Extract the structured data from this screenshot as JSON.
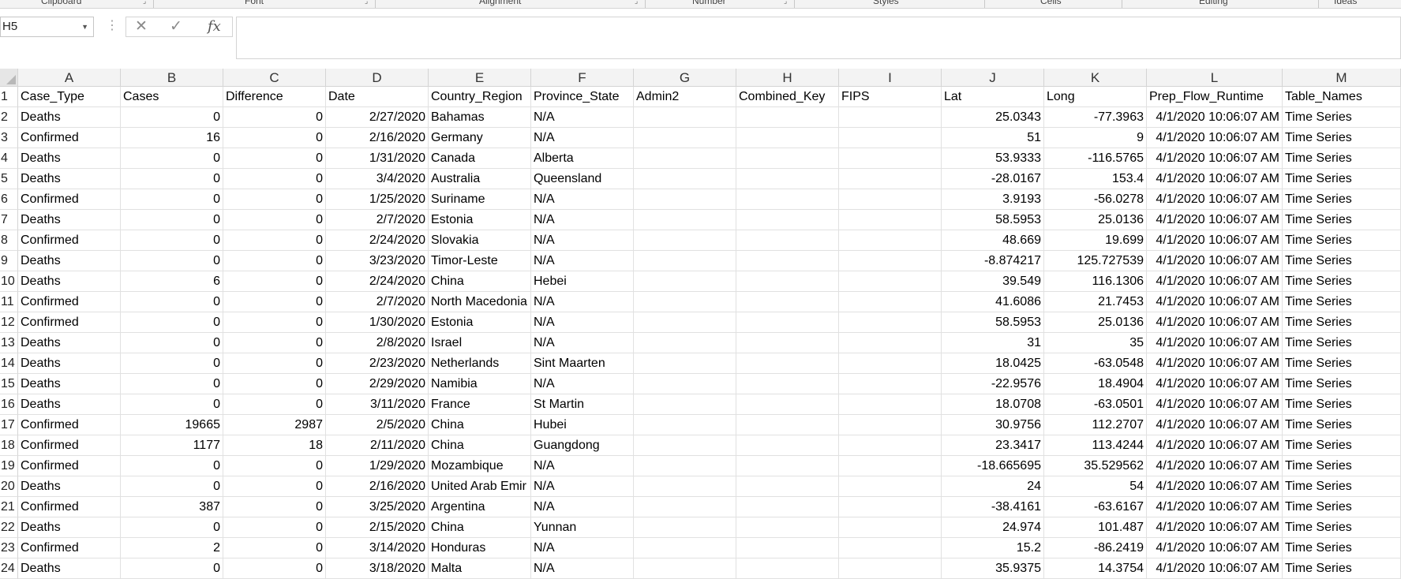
{
  "ribbon_groups": [
    "Clipboard",
    "Font",
    "Alignment",
    "Number",
    "Styles",
    "Cells",
    "Editing",
    "Ideas"
  ],
  "formula_bar": {
    "name_box": "H5",
    "cancel_icon": "✕",
    "enter_icon": "✓",
    "function_label": "fx",
    "formula_value": ""
  },
  "columns": [
    "A",
    "B",
    "C",
    "D",
    "E",
    "F",
    "G",
    "H",
    "I",
    "J",
    "K",
    "L",
    "M"
  ],
  "rows": [
    {
      "n": "1",
      "cells": [
        "Case_Type",
        "Cases",
        "Difference",
        "Date",
        "Country_Region",
        "Province_State",
        "Admin2",
        "Combined_Key",
        "FIPS",
        "Lat",
        "Long",
        "Prep_Flow_Runtime",
        "Table_Names"
      ]
    },
    {
      "n": "2",
      "cells": [
        "Deaths",
        "0",
        "0",
        "2/27/2020",
        "Bahamas",
        "N/A",
        "",
        "",
        "",
        "25.0343",
        "-77.3963",
        "4/1/2020 10:06:07 AM",
        "Time Series"
      ]
    },
    {
      "n": "3",
      "cells": [
        "Confirmed",
        "16",
        "0",
        "2/16/2020",
        "Germany",
        "N/A",
        "",
        "",
        "",
        "51",
        "9",
        "4/1/2020 10:06:07 AM",
        "Time Series"
      ]
    },
    {
      "n": "4",
      "cells": [
        "Deaths",
        "0",
        "0",
        "1/31/2020",
        "Canada",
        "Alberta",
        "",
        "",
        "",
        "53.9333",
        "-116.5765",
        "4/1/2020 10:06:07 AM",
        "Time Series"
      ]
    },
    {
      "n": "5",
      "cells": [
        "Deaths",
        "0",
        "0",
        "3/4/2020",
        "Australia",
        "Queensland",
        "",
        "",
        "",
        "-28.0167",
        "153.4",
        "4/1/2020 10:06:07 AM",
        "Time Series"
      ]
    },
    {
      "n": "6",
      "cells": [
        "Confirmed",
        "0",
        "0",
        "1/25/2020",
        "Suriname",
        "N/A",
        "",
        "",
        "",
        "3.9193",
        "-56.0278",
        "4/1/2020 10:06:07 AM",
        "Time Series"
      ]
    },
    {
      "n": "7",
      "cells": [
        "Deaths",
        "0",
        "0",
        "2/7/2020",
        "Estonia",
        "N/A",
        "",
        "",
        "",
        "58.5953",
        "25.0136",
        "4/1/2020 10:06:07 AM",
        "Time Series"
      ]
    },
    {
      "n": "8",
      "cells": [
        "Confirmed",
        "0",
        "0",
        "2/24/2020",
        "Slovakia",
        "N/A",
        "",
        "",
        "",
        "48.669",
        "19.699",
        "4/1/2020 10:06:07 AM",
        "Time Series"
      ]
    },
    {
      "n": "9",
      "cells": [
        "Deaths",
        "0",
        "0",
        "3/23/2020",
        "Timor-Leste",
        "N/A",
        "",
        "",
        "",
        "-8.874217",
        "125.727539",
        "4/1/2020 10:06:07 AM",
        "Time Series"
      ]
    },
    {
      "n": "10",
      "cells": [
        "Deaths",
        "6",
        "0",
        "2/24/2020",
        "China",
        "Hebei",
        "",
        "",
        "",
        "39.549",
        "116.1306",
        "4/1/2020 10:06:07 AM",
        "Time Series"
      ]
    },
    {
      "n": "11",
      "cells": [
        "Confirmed",
        "0",
        "0",
        "2/7/2020",
        "North Macedonia",
        "N/A",
        "",
        "",
        "",
        "41.6086",
        "21.7453",
        "4/1/2020 10:06:07 AM",
        "Time Series"
      ]
    },
    {
      "n": "12",
      "cells": [
        "Confirmed",
        "0",
        "0",
        "1/30/2020",
        "Estonia",
        "N/A",
        "",
        "",
        "",
        "58.5953",
        "25.0136",
        "4/1/2020 10:06:07 AM",
        "Time Series"
      ]
    },
    {
      "n": "13",
      "cells": [
        "Deaths",
        "0",
        "0",
        "2/8/2020",
        "Israel",
        "N/A",
        "",
        "",
        "",
        "31",
        "35",
        "4/1/2020 10:06:07 AM",
        "Time Series"
      ]
    },
    {
      "n": "14",
      "cells": [
        "Deaths",
        "0",
        "0",
        "2/23/2020",
        "Netherlands",
        "Sint Maarten",
        "",
        "",
        "",
        "18.0425",
        "-63.0548",
        "4/1/2020 10:06:07 AM",
        "Time Series"
      ]
    },
    {
      "n": "15",
      "cells": [
        "Deaths",
        "0",
        "0",
        "2/29/2020",
        "Namibia",
        "N/A",
        "",
        "",
        "",
        "-22.9576",
        "18.4904",
        "4/1/2020 10:06:07 AM",
        "Time Series"
      ]
    },
    {
      "n": "16",
      "cells": [
        "Deaths",
        "0",
        "0",
        "3/11/2020",
        "France",
        "St Martin",
        "",
        "",
        "",
        "18.0708",
        "-63.0501",
        "4/1/2020 10:06:07 AM",
        "Time Series"
      ]
    },
    {
      "n": "17",
      "cells": [
        "Confirmed",
        "19665",
        "2987",
        "2/5/2020",
        "China",
        "Hubei",
        "",
        "",
        "",
        "30.9756",
        "112.2707",
        "4/1/2020 10:06:07 AM",
        "Time Series"
      ]
    },
    {
      "n": "18",
      "cells": [
        "Confirmed",
        "1177",
        "18",
        "2/11/2020",
        "China",
        "Guangdong",
        "",
        "",
        "",
        "23.3417",
        "113.4244",
        "4/1/2020 10:06:07 AM",
        "Time Series"
      ]
    },
    {
      "n": "19",
      "cells": [
        "Confirmed",
        "0",
        "0",
        "1/29/2020",
        "Mozambique",
        "N/A",
        "",
        "",
        "",
        "-18.665695",
        "35.529562",
        "4/1/2020 10:06:07 AM",
        "Time Series"
      ]
    },
    {
      "n": "20",
      "cells": [
        "Deaths",
        "0",
        "0",
        "2/16/2020",
        "United Arab Emir",
        "N/A",
        "",
        "",
        "",
        "24",
        "54",
        "4/1/2020 10:06:07 AM",
        "Time Series"
      ]
    },
    {
      "n": "21",
      "cells": [
        "Confirmed",
        "387",
        "0",
        "3/25/2020",
        "Argentina",
        "N/A",
        "",
        "",
        "",
        "-38.4161",
        "-63.6167",
        "4/1/2020 10:06:07 AM",
        "Time Series"
      ]
    },
    {
      "n": "22",
      "cells": [
        "Deaths",
        "0",
        "0",
        "2/15/2020",
        "China",
        "Yunnan",
        "",
        "",
        "",
        "24.974",
        "101.487",
        "4/1/2020 10:06:07 AM",
        "Time Series"
      ]
    },
    {
      "n": "23",
      "cells": [
        "Confirmed",
        "2",
        "0",
        "3/14/2020",
        "Honduras",
        "N/A",
        "",
        "",
        "",
        "15.2",
        "-86.2419",
        "4/1/2020 10:06:07 AM",
        "Time Series"
      ]
    },
    {
      "n": "24",
      "cells": [
        "Deaths",
        "0",
        "0",
        "3/18/2020",
        "Malta",
        "N/A",
        "",
        "",
        "",
        "35.9375",
        "14.3754",
        "4/1/2020 10:06:07 AM",
        "Time Series"
      ]
    }
  ]
}
